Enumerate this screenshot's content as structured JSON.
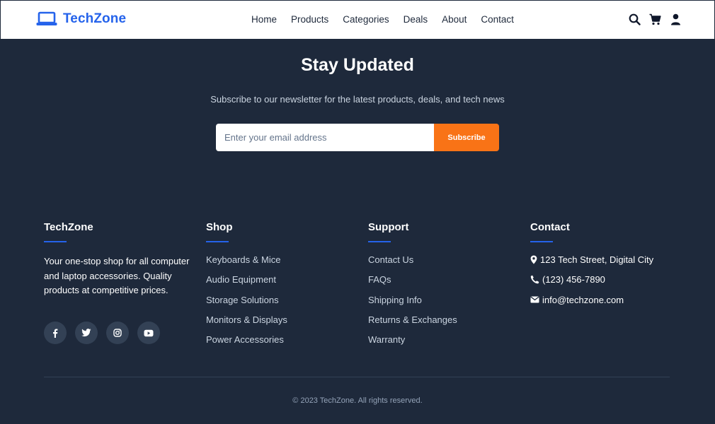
{
  "header": {
    "brand": "TechZone",
    "nav": [
      "Home",
      "Products",
      "Categories",
      "Deals",
      "About",
      "Contact"
    ],
    "icons": [
      "search-icon",
      "cart-icon",
      "user-icon"
    ]
  },
  "newsletter": {
    "title": "Stay Updated",
    "subtitle": "Subscribe to our newsletter for the latest products, deals, and tech news",
    "placeholder": "Enter your email address",
    "button": "Subscribe"
  },
  "footer": {
    "about": {
      "title": "TechZone",
      "text": "Your one-stop shop for all computer and laptop accessories. Quality products at competitive prices.",
      "socials": [
        "facebook-icon",
        "twitter-icon",
        "instagram-icon",
        "youtube-icon"
      ]
    },
    "shop": {
      "title": "Shop",
      "links": [
        "Keyboards & Mice",
        "Audio Equipment",
        "Storage Solutions",
        "Monitors & Displays",
        "Power Accessories"
      ]
    },
    "support": {
      "title": "Support",
      "links": [
        "Contact Us",
        "FAQs",
        "Shipping Info",
        "Returns & Exchanges",
        "Warranty"
      ]
    },
    "contact": {
      "title": "Contact",
      "address": "123 Tech Street, Digital City",
      "phone": "(123) 456-7890",
      "email": "info@techzone.com"
    },
    "copyright": "© 2023 TechZone. All rights reserved."
  },
  "colors": {
    "accent": "#2563eb",
    "cta": "#f97316",
    "background": "#1e293b"
  }
}
